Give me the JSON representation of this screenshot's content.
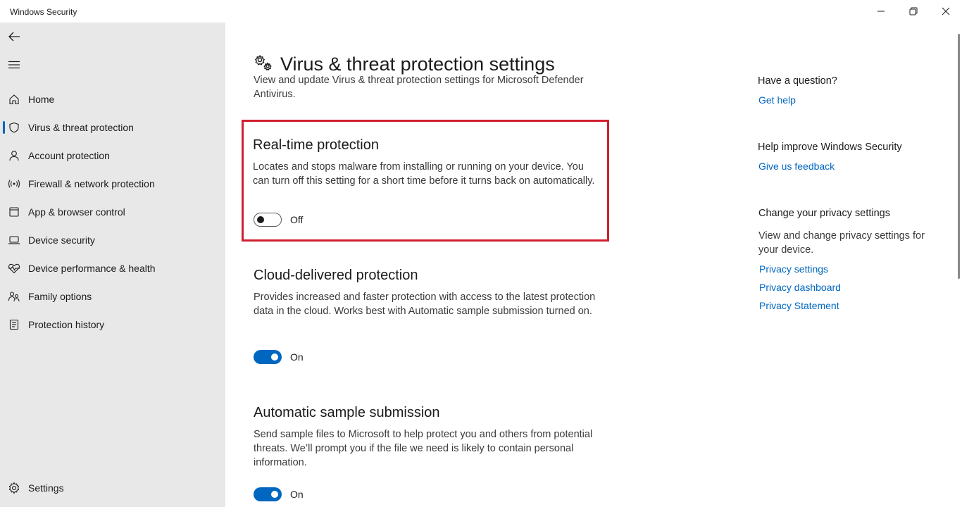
{
  "window": {
    "title": "Windows Security",
    "controls": [
      "minimize-icon",
      "restore-icon",
      "close-icon"
    ]
  },
  "sidebar": {
    "back_icon": "back-arrow-icon",
    "menu_icon": "hamburger-icon",
    "items": [
      {
        "label": "Home",
        "icon": "home-icon",
        "selected": false
      },
      {
        "label": "Virus & threat protection",
        "icon": "shield-icon",
        "selected": true
      },
      {
        "label": "Account protection",
        "icon": "person-icon",
        "selected": false
      },
      {
        "label": "Firewall & network protection",
        "icon": "wifi-signal-icon",
        "selected": false
      },
      {
        "label": "App & browser control",
        "icon": "app-window-icon",
        "selected": false
      },
      {
        "label": "Device security",
        "icon": "laptop-icon",
        "selected": false
      },
      {
        "label": "Device performance & health",
        "icon": "heart-pulse-icon",
        "selected": false
      },
      {
        "label": "Family options",
        "icon": "family-icon",
        "selected": false
      },
      {
        "label": "Protection history",
        "icon": "history-icon",
        "selected": false
      }
    ],
    "settings": {
      "label": "Settings",
      "icon": "gear-icon"
    }
  },
  "main": {
    "title": "Virus & threat protection settings",
    "title_icon": "gears-icon",
    "description": "View and update Virus & threat protection settings for Microsoft Defender Antivirus.",
    "sections": [
      {
        "title": "Real-time protection",
        "description": "Locates and stops malware from installing or running on your device. You can turn off this setting for a short time before it turns back on automatically.",
        "toggle_state": "Off",
        "highlighted": true
      },
      {
        "title": "Cloud-delivered protection",
        "description": "Provides increased and faster protection with access to the latest protection data in the cloud. Works best with Automatic sample submission turned on.",
        "toggle_state": "On",
        "highlighted": false
      },
      {
        "title": "Automatic sample submission",
        "description": "Send sample files to Microsoft to help protect you and others from potential threats. We’ll prompt you if the file we need is likely to contain personal information.",
        "toggle_state": "On",
        "highlighted": false
      }
    ],
    "highlight_color": "#d01f2f",
    "accent_color": "#0067c0"
  },
  "right_panel": {
    "question": {
      "heading": "Have a question?",
      "link": "Get help"
    },
    "improve": {
      "heading": "Help improve Windows Security",
      "link": "Give us feedback"
    },
    "privacy": {
      "heading": "Change your privacy settings",
      "text": "View and change privacy settings for your  device.",
      "links": [
        "Privacy settings",
        "Privacy dashboard",
        "Privacy Statement"
      ]
    }
  }
}
